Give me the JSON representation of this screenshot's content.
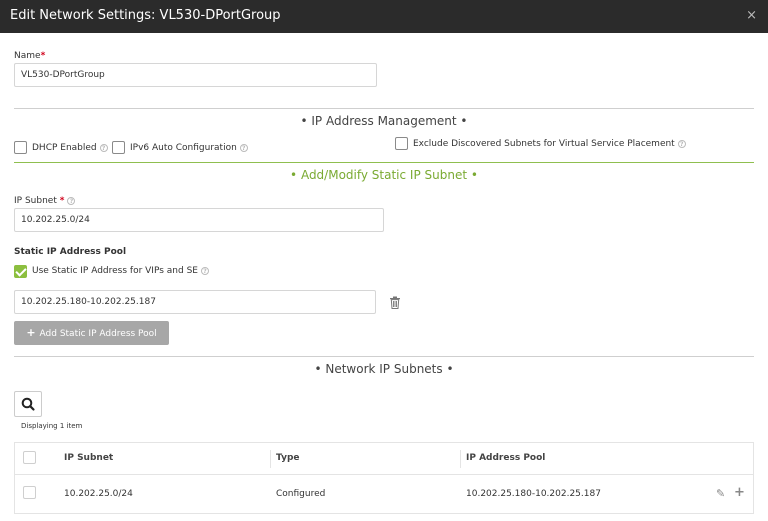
{
  "window": {
    "title": "Edit Network Settings: VL530-DPortGroup",
    "close_glyph": "×"
  },
  "name_field": {
    "label": "Name",
    "required_mark": "*",
    "value": "VL530-DPortGroup"
  },
  "ip_mgmt": {
    "title": "• IP Address Management •",
    "dhcp_label": "DHCP Enabled",
    "ipv6_label": "IPv6 Auto Configuration",
    "exclude_label": "Exclude Discovered Subnets for Virtual Service Placement"
  },
  "static_subnet": {
    "title": "• Add/Modify Static IP Subnet •",
    "ip_subnet_label": "IP Subnet",
    "required_mark": "*",
    "ip_subnet_value": "10.202.25.0/24",
    "pool_heading": "Static IP Address Pool",
    "use_static_label": "Use Static IP Address for VIPs and SE",
    "pool_value": "10.202.25.180-10.202.25.187",
    "add_pool_label": "Add Static IP Address Pool",
    "add_pool_plus": "+"
  },
  "network_subnets": {
    "title": "• Network IP Subnets •",
    "displaying": "Displaying 1 item",
    "columns": [
      "IP Subnet",
      "Type",
      "IP Address Pool"
    ],
    "rows": [
      {
        "ip_subnet": "10.202.25.0/24",
        "type": "Configured",
        "pool": "10.202.25.180-10.202.25.187"
      }
    ],
    "row_edit_glyph": "✎",
    "row_add_glyph": "+"
  },
  "help_glyph": "?",
  "colors": {
    "titlebar": "#2b2b2b",
    "accent_green": "#8cbf3f",
    "section_green_text": "#7aaa32",
    "required": "#d0021b"
  }
}
